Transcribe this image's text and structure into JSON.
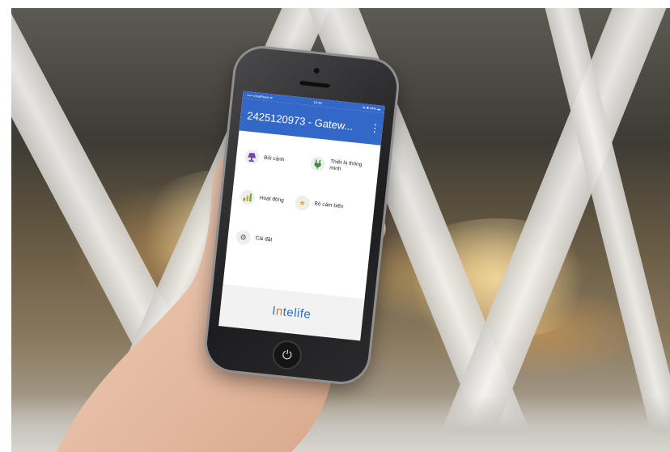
{
  "status_bar": {
    "carrier": "••••• VinaPhone ≋",
    "time": "10:38",
    "battery": "⊕ ✱ 94% ▬"
  },
  "app_bar": {
    "title": "2425120973 - Gatew...",
    "menu_icon": "more-vertical-icon"
  },
  "tiles": [
    {
      "label": "Bối cảnh",
      "icon": "lamp-icon"
    },
    {
      "label": "Thiết bị thông minh",
      "icon": "plug-icon"
    },
    {
      "label": "Hoạt động",
      "icon": "bar-chart-icon"
    },
    {
      "label": "Bộ cảm biến",
      "icon": "star-icon"
    },
    {
      "label": "Cài đặt",
      "icon": "gear-icon"
    }
  ],
  "brand": {
    "prefix": "I",
    "mark": "n",
    "suffix": "telife"
  },
  "colors": {
    "app_bar": "#3468c8",
    "brand": "#2f6fbf",
    "brand_accent": "#e2792d"
  },
  "home_button": {
    "icon": "power-icon",
    "glyph": "⏻"
  }
}
